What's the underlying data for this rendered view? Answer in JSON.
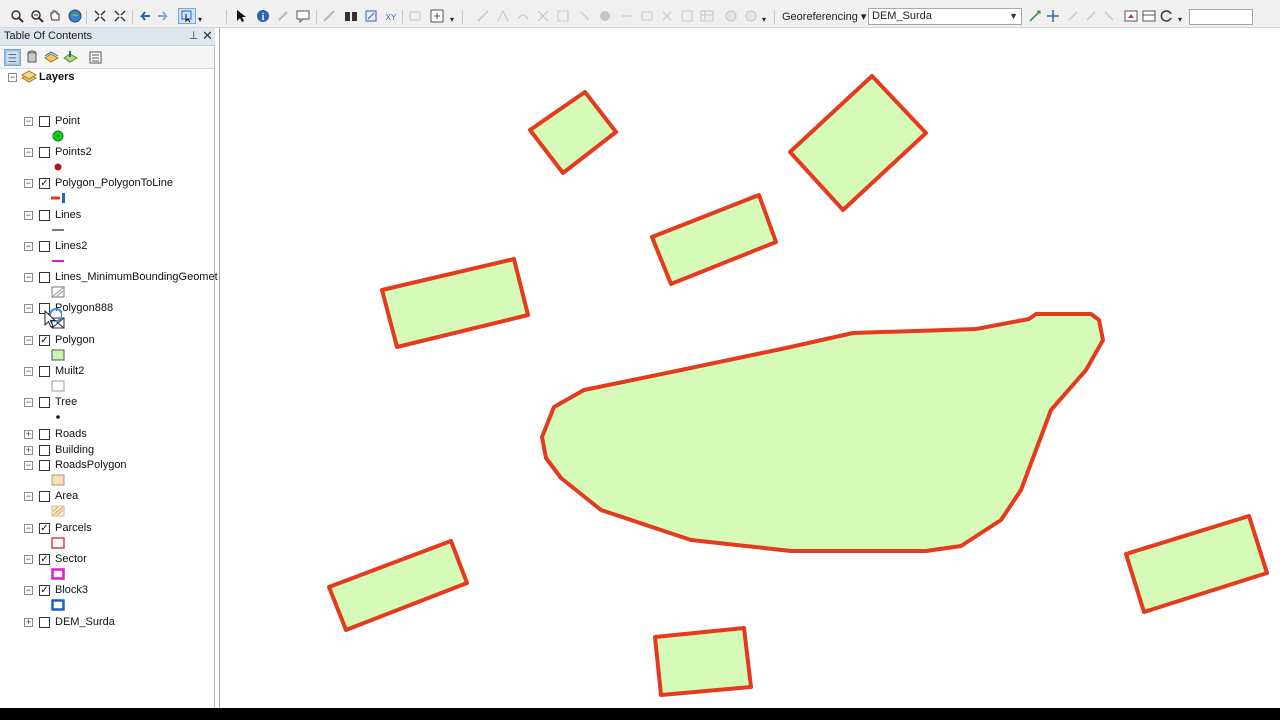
{
  "toolbar": {
    "georef_label": "Georeferencing",
    "layer_dropdown_value": "DEM_Surda",
    "scale_value": ""
  },
  "toc": {
    "title": "Table Of Contents",
    "root_label": "Layers",
    "layers": [
      {
        "name": "Point",
        "checked": false,
        "symbol": "green-dot"
      },
      {
        "name": "Points2",
        "checked": false,
        "symbol": "red-dot"
      },
      {
        "name": "Polygon_PolygonToLine",
        "checked": true,
        "symbol": "red-blue-line"
      },
      {
        "name": "Lines",
        "checked": false,
        "symbol": "gray-line"
      },
      {
        "name": "Lines2",
        "checked": false,
        "symbol": "magenta-line"
      },
      {
        "name": "Lines_MinimumBoundingGeomet",
        "checked": false,
        "symbol": "hatched-box"
      },
      {
        "name": "Polygon888",
        "checked": false,
        "symbol": "cross-box"
      },
      {
        "name": "Polygon",
        "checked": true,
        "symbol": "green-box"
      },
      {
        "name": "Muilt2",
        "checked": false,
        "symbol": "white-box"
      },
      {
        "name": "Tree",
        "checked": false,
        "symbol": "black-dot"
      },
      {
        "name": "Roads",
        "checked": false,
        "symbol": "none"
      },
      {
        "name": "Building",
        "checked": false,
        "symbol": "none"
      },
      {
        "name": "RoadsPolygon",
        "checked": false,
        "symbol": "tan-box"
      },
      {
        "name": "Area",
        "checked": false,
        "symbol": "orange-hatch-box"
      },
      {
        "name": "Parcels",
        "checked": true,
        "symbol": "red-outline-box"
      },
      {
        "name": "Sector",
        "checked": true,
        "symbol": "magenta-outline-box"
      },
      {
        "name": "Block3",
        "checked": true,
        "symbol": "blue-outline-box"
      },
      {
        "name": "DEM_Surda",
        "checked": false,
        "symbol": "none"
      }
    ]
  },
  "map": {
    "fill_color": "#d6fbb8",
    "stroke_color": "#e43a1e"
  },
  "colors": {
    "toc_header_bg": "#dfe6ee",
    "statusbar": "#000000"
  }
}
